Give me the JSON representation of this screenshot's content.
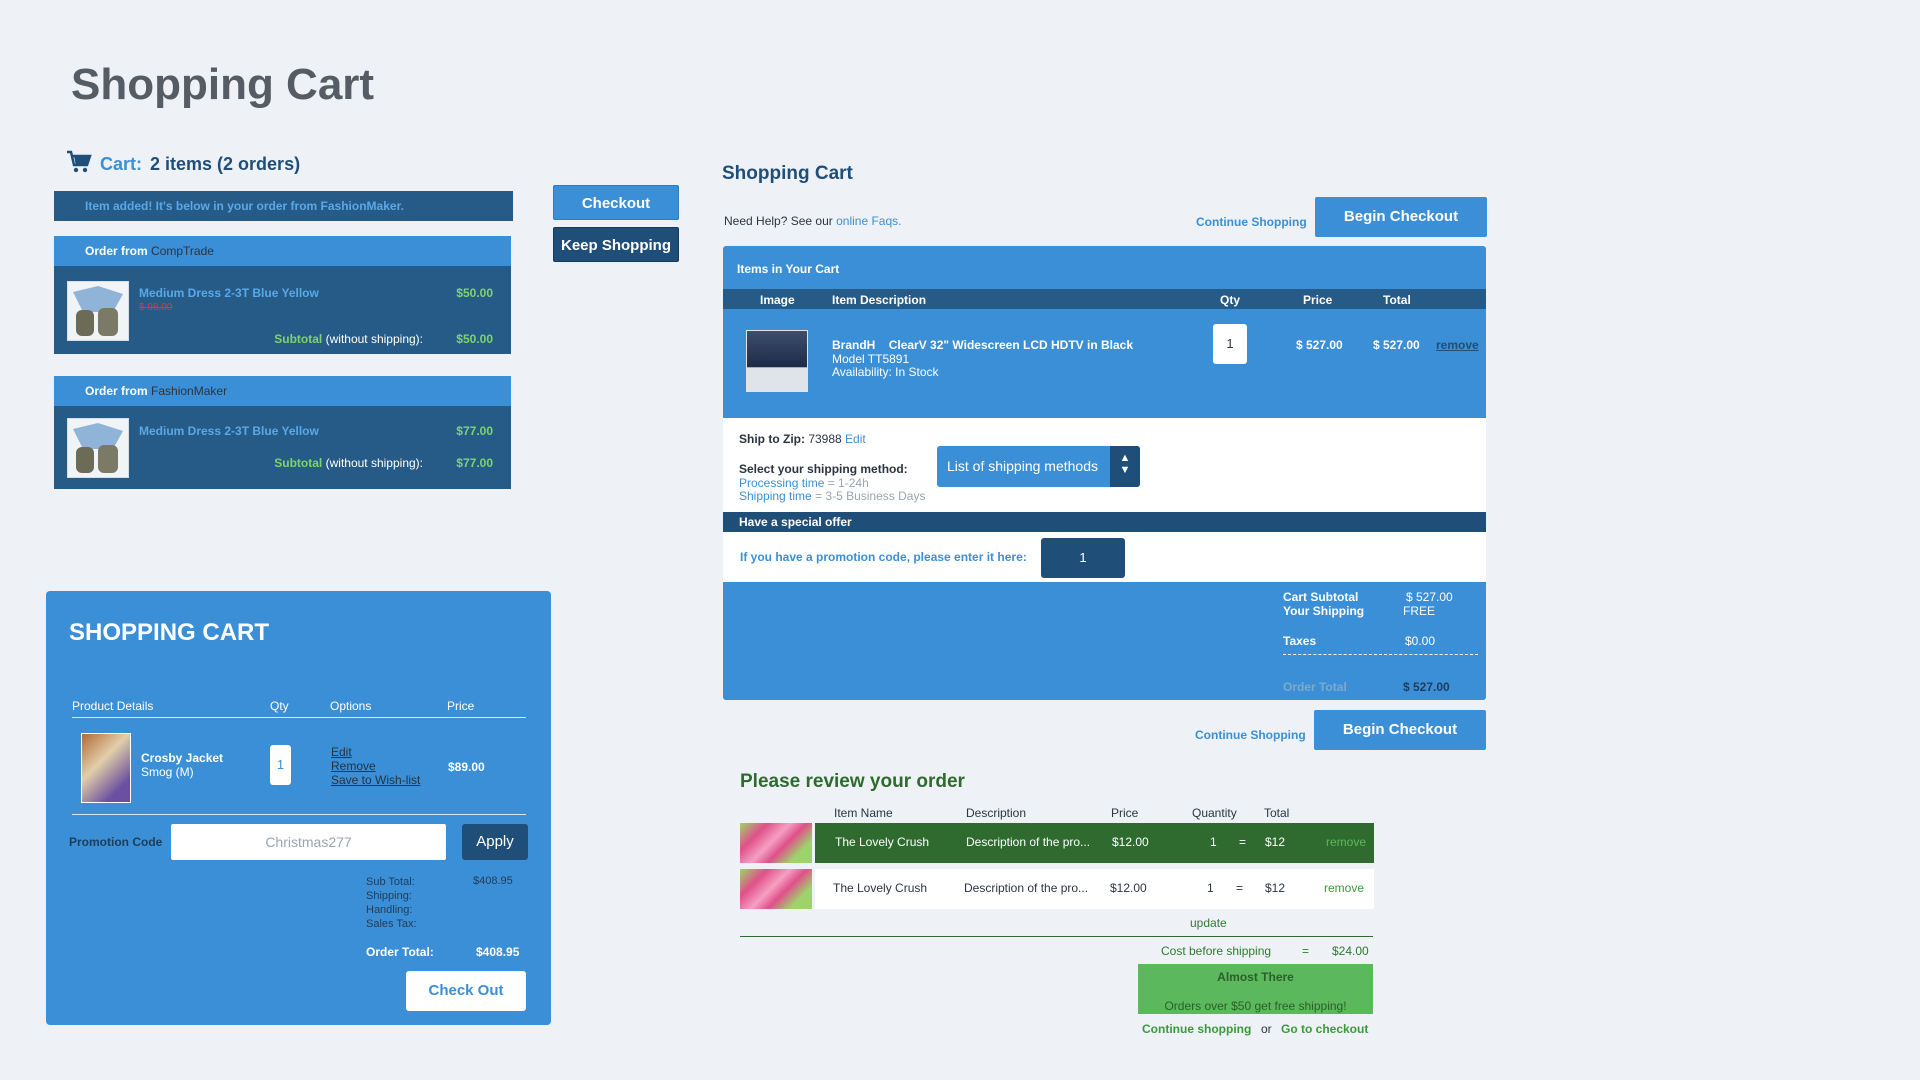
{
  "page_title": "Shopping Cart",
  "panel1": {
    "cart_label": "Cart:",
    "cart_count": "2 items (2 orders)",
    "banner": "Item added! It's below in your order from FashionMaker.",
    "order_from_label": "Order from",
    "orders": [
      {
        "store": "CompTrade",
        "item": "Medium Dress 2-3T Blue Yellow",
        "old_price": "$ 98.00",
        "price": "$50.00",
        "subtotal": "$50.00"
      },
      {
        "store": "FashionMaker",
        "item": "Medium Dress 2-3T Blue Yellow",
        "price": "$77.00",
        "subtotal": "$77.00"
      }
    ],
    "subtotal_label": "Subtotal",
    "subtotal_note": "(without shipping):",
    "checkout_button": "Checkout",
    "keep_shopping_button": "Keep Shopping"
  },
  "panel2": {
    "title": "SHOPPING CART",
    "headers": {
      "details": "Product Details",
      "qty": "Qty",
      "options": "Options",
      "price": "Price"
    },
    "product": {
      "name": "Crosby Jacket",
      "variant": "Smog (M)",
      "qty": "1",
      "price": "$89.00"
    },
    "options": [
      "Edit",
      "Remove",
      "Save to Wish-list"
    ],
    "promo_label": "Promotion Code",
    "promo_value": "Christmas277",
    "apply_button": "Apply",
    "totals_labels": [
      "Sub Total:",
      "Shipping:",
      "Handling:",
      "Sales Tax:"
    ],
    "sub_total": "$408.95",
    "order_total_label": "Order Total:",
    "order_total": "$408.95",
    "checkout_button": "Check Out"
  },
  "panel3": {
    "title": "Shopping Cart",
    "help_text": "Need Help? See our",
    "help_link": "online Faqs.",
    "continue_shopping": "Continue Shopping",
    "begin_checkout": "Begin Checkout",
    "items_title": "Items in Your Cart",
    "headers": {
      "image": "Image",
      "desc": "Item Description",
      "qty": "Qty",
      "price": "Price",
      "total": "Total"
    },
    "item": {
      "brand": "BrandH",
      "name": "ClearV 32\" Widescreen LCD HDTV in Black",
      "model": "Model TT5891",
      "availability": "Availability: In Stock",
      "qty": "1",
      "price": "$ 527.00",
      "total": "$ 527.00",
      "remove": "remove"
    },
    "ship_zip_label": "Ship to Zip:",
    "ship_zip": "73988",
    "edit": "Edit",
    "select_method_label": "Select your shipping method:",
    "processing_label": "Processing time",
    "processing_value": "= 1-24h",
    "shipping_time_label": "Shipping time",
    "shipping_time_value": "= 3-5 Business Days",
    "shipping_select": "List of shipping methods",
    "special_offer": "Have a special offer",
    "promo_text": "If you have a promotion code, please enter it here:",
    "promo_value": "1",
    "totals": {
      "cart_subtotal_label": "Cart Subtotal",
      "cart_subtotal": "$ 527.00",
      "shipping_label": "Your Shipping",
      "shipping": "FREE",
      "taxes_label": "Taxes",
      "taxes": "$0.00",
      "order_total_label": "Order Total",
      "order_total": "$ 527.00"
    }
  },
  "panel4": {
    "title": "Please review your order",
    "headers": {
      "name": "Item Name",
      "desc": "Description",
      "price": "Price",
      "qty": "Quantity",
      "total": "Total"
    },
    "rows": [
      {
        "name": "The Lovely Crush",
        "desc": "Description of the pro...",
        "price": "$12.00",
        "qty": "1",
        "eq": "=",
        "total": "$12",
        "remove": "remove"
      },
      {
        "name": "The Lovely Crush",
        "desc": "Description of the pro...",
        "price": "$12.00",
        "qty": "1",
        "eq": "=",
        "total": "$12",
        "remove": "remove"
      }
    ],
    "update": "update",
    "cost_before_label": "Cost before shipping",
    "cost_before_eq": "=",
    "cost_before": "$24.00",
    "almost_title": "Almost There",
    "almost_text": "Orders over $50 get free shipping!",
    "continue": "Continue shopping",
    "or": "or",
    "go_checkout": "Go to checkout"
  },
  "colors": {
    "primary_blue": "#3b8fd6",
    "dark_blue": "#1f4e79",
    "green": "#5cb85c",
    "dark_green": "#2f6b2f",
    "background": "#eef2f6"
  }
}
